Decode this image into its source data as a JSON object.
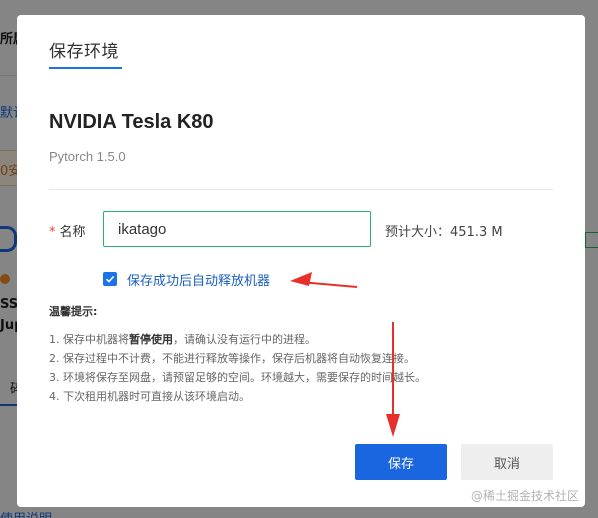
{
  "background": {
    "fragments": [
      "所属",
      "默认",
      "0安",
      "SSI",
      "Jup",
      "碎",
      "使用说明"
    ],
    "accent": "#f04438"
  },
  "modal": {
    "title": "保存环境",
    "gpu_name": "NVIDIA Tesla K80",
    "framework": "Pytorch 1.5.0",
    "name_field": {
      "required_mark": "*",
      "label": "名称",
      "value": "ikatago"
    },
    "estimated_size": "预计大小：451.3 M",
    "auto_release": {
      "checked": true,
      "label": "保存成功后自动释放机器"
    },
    "tips": {
      "title": "温馨提示:",
      "items": [
        {
          "before": "1. 保存中机器将",
          "bold": "暂停使用",
          "after": "，请确认没有运行中的进程。"
        },
        {
          "before": "2. 保存过程中不计费，不能进行释放等操作，保存后机器将自动恢复连接。",
          "bold": "",
          "after": ""
        },
        {
          "before": "3. 环境将保存至网盘，请预留足够的空间。环境越大，需要保存的时间越长。",
          "bold": "",
          "after": ""
        },
        {
          "before": "4. 下次租用机器时可直接从该环境启动。",
          "bold": "",
          "after": ""
        }
      ]
    },
    "save_label": "保存",
    "cancel_label": "取消"
  },
  "watermark": "@稀土掘金技术社区",
  "colors": {
    "primary": "#1a66e0",
    "input_border": "#27b36a",
    "annotation_arrow": "#e8302a"
  }
}
